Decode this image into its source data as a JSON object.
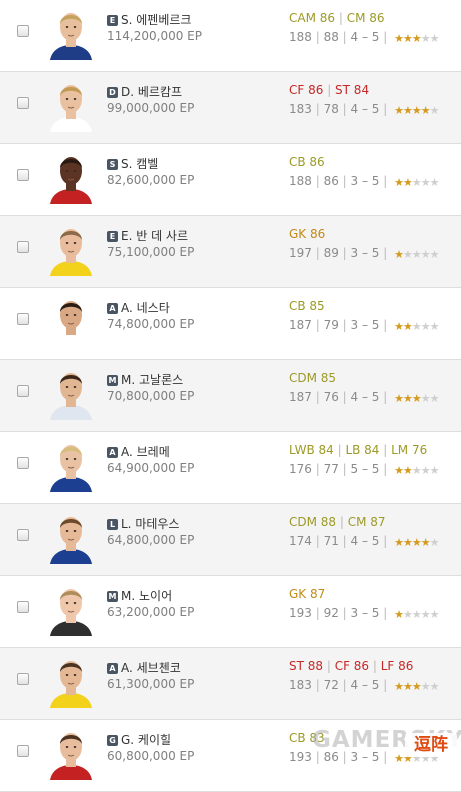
{
  "colors": {
    "cam_cm_cdm_cb_lwb_lb_lm": "#9c9a27",
    "attacker": "#c62828",
    "goalkeeper": "#c28a16",
    "star_on": "#d59a1e"
  },
  "players": [
    {
      "tier": "E",
      "name": "S. 에펜베르크",
      "price": "114,200,000 EP",
      "positions": [
        {
          "label": "CAM 86",
          "color": "#9c9a27"
        },
        {
          "label": "CM 86",
          "color": "#9c9a27"
        }
      ],
      "height": "188",
      "weight": "88",
      "skills": "4 – 5",
      "stars": 3,
      "face": {
        "skin": "#e8bf9c",
        "hair": "#c5a15e",
        "shirt": "#1f3c86"
      }
    },
    {
      "tier": "D",
      "name": "D. 베르캄프",
      "price": "99,000,000 EP",
      "positions": [
        {
          "label": "CF 86",
          "color": "#c62828"
        },
        {
          "label": "ST 84",
          "color": "#c62828"
        }
      ],
      "height": "183",
      "weight": "78",
      "skills": "4 – 5",
      "stars": 4,
      "face": {
        "skin": "#e9c0a0",
        "hair": "#c49a53",
        "shirt": "#ffffff"
      }
    },
    {
      "tier": "S",
      "name": "S. 캠벨",
      "price": "82,600,000 EP",
      "positions": [
        {
          "label": "CB 86",
          "color": "#9c9a27"
        }
      ],
      "height": "188",
      "weight": "86",
      "skills": "3 – 5",
      "stars": 2,
      "face": {
        "skin": "#5b3424",
        "hair": "#2a1a12",
        "shirt": "#c42222"
      }
    },
    {
      "tier": "E",
      "name": "E. 반 데 사르",
      "price": "75,100,000 EP",
      "positions": [
        {
          "label": "GK 86",
          "color": "#c28a16"
        }
      ],
      "height": "197",
      "weight": "89",
      "skills": "3 – 5",
      "stars": 1,
      "face": {
        "skin": "#e8bc9c",
        "hair": "#8a6a48",
        "shirt": "#f2d21a"
      }
    },
    {
      "tier": "A",
      "name": "A. 네스타",
      "price": "74,800,000 EP",
      "positions": [
        {
          "label": "CB 85",
          "color": "#9c9a27"
        }
      ],
      "height": "187",
      "weight": "79",
      "skills": "3 – 5",
      "stars": 2,
      "face": {
        "skin": "#d9a985",
        "hair": "#2b1c14",
        "shirt": "#ffffff"
      }
    },
    {
      "tier": "M",
      "name": "M. 고날론스",
      "price": "70,800,000 EP",
      "positions": [
        {
          "label": "CDM 85",
          "color": "#9c9a27"
        }
      ],
      "height": "187",
      "weight": "76",
      "skills": "4 – 5",
      "stars": 3,
      "face": {
        "skin": "#e1b692",
        "hair": "#3a2618",
        "shirt": "#e0e6ef"
      }
    },
    {
      "tier": "A",
      "name": "A. 브레메",
      "price": "64,900,000 EP",
      "positions": [
        {
          "label": "LWB 84",
          "color": "#9c9a27"
        },
        {
          "label": "LB 84",
          "color": "#9c9a27"
        },
        {
          "label": "LM 76",
          "color": "#9c9a27"
        }
      ],
      "height": "176",
      "weight": "77",
      "skills": "5 – 5",
      "stars": 2,
      "face": {
        "skin": "#e9c2a4",
        "hair": "#d8bc7e",
        "shirt": "#1c3f92"
      }
    },
    {
      "tier": "L",
      "name": "L. 마테우스",
      "price": "64,800,000 EP",
      "positions": [
        {
          "label": "CDM 88",
          "color": "#9c9a27"
        },
        {
          "label": "CM 87",
          "color": "#9c9a27"
        }
      ],
      "height": "174",
      "weight": "71",
      "skills": "4 – 5",
      "stars": 4,
      "face": {
        "skin": "#e6ba98",
        "hair": "#6b4a2c",
        "shirt": "#1c3f92"
      }
    },
    {
      "tier": "M",
      "name": "M. 노이어",
      "price": "63,200,000 EP",
      "positions": [
        {
          "label": "GK 87",
          "color": "#c28a16"
        }
      ],
      "height": "193",
      "weight": "92",
      "skills": "3 – 5",
      "stars": 1,
      "face": {
        "skin": "#efc7aa",
        "hair": "#b08d5c",
        "shirt": "#2f2f2f"
      }
    },
    {
      "tier": "A",
      "name": "A. 세브첸코",
      "price": "61,300,000 EP",
      "positions": [
        {
          "label": "ST 88",
          "color": "#c62828"
        },
        {
          "label": "CF 86",
          "color": "#c62828"
        },
        {
          "label": "LF 86",
          "color": "#c62828"
        }
      ],
      "height": "183",
      "weight": "72",
      "skills": "4 – 5",
      "stars": 3,
      "face": {
        "skin": "#e4b894",
        "hair": "#4a3322",
        "shirt": "#f2d21a"
      }
    },
    {
      "tier": "G",
      "name": "G. 케이힐",
      "price": "60,800,000 EP",
      "positions": [
        {
          "label": "CB 83",
          "color": "#9c9a27"
        }
      ],
      "height": "193",
      "weight": "86",
      "skills": "3 – 5",
      "stars": 2,
      "face": {
        "skin": "#e7bd9e",
        "hair": "#4c3222",
        "shirt": "#c42222"
      }
    }
  ],
  "watermark": "GAMERSKY",
  "watermark_logo": "逗阵"
}
